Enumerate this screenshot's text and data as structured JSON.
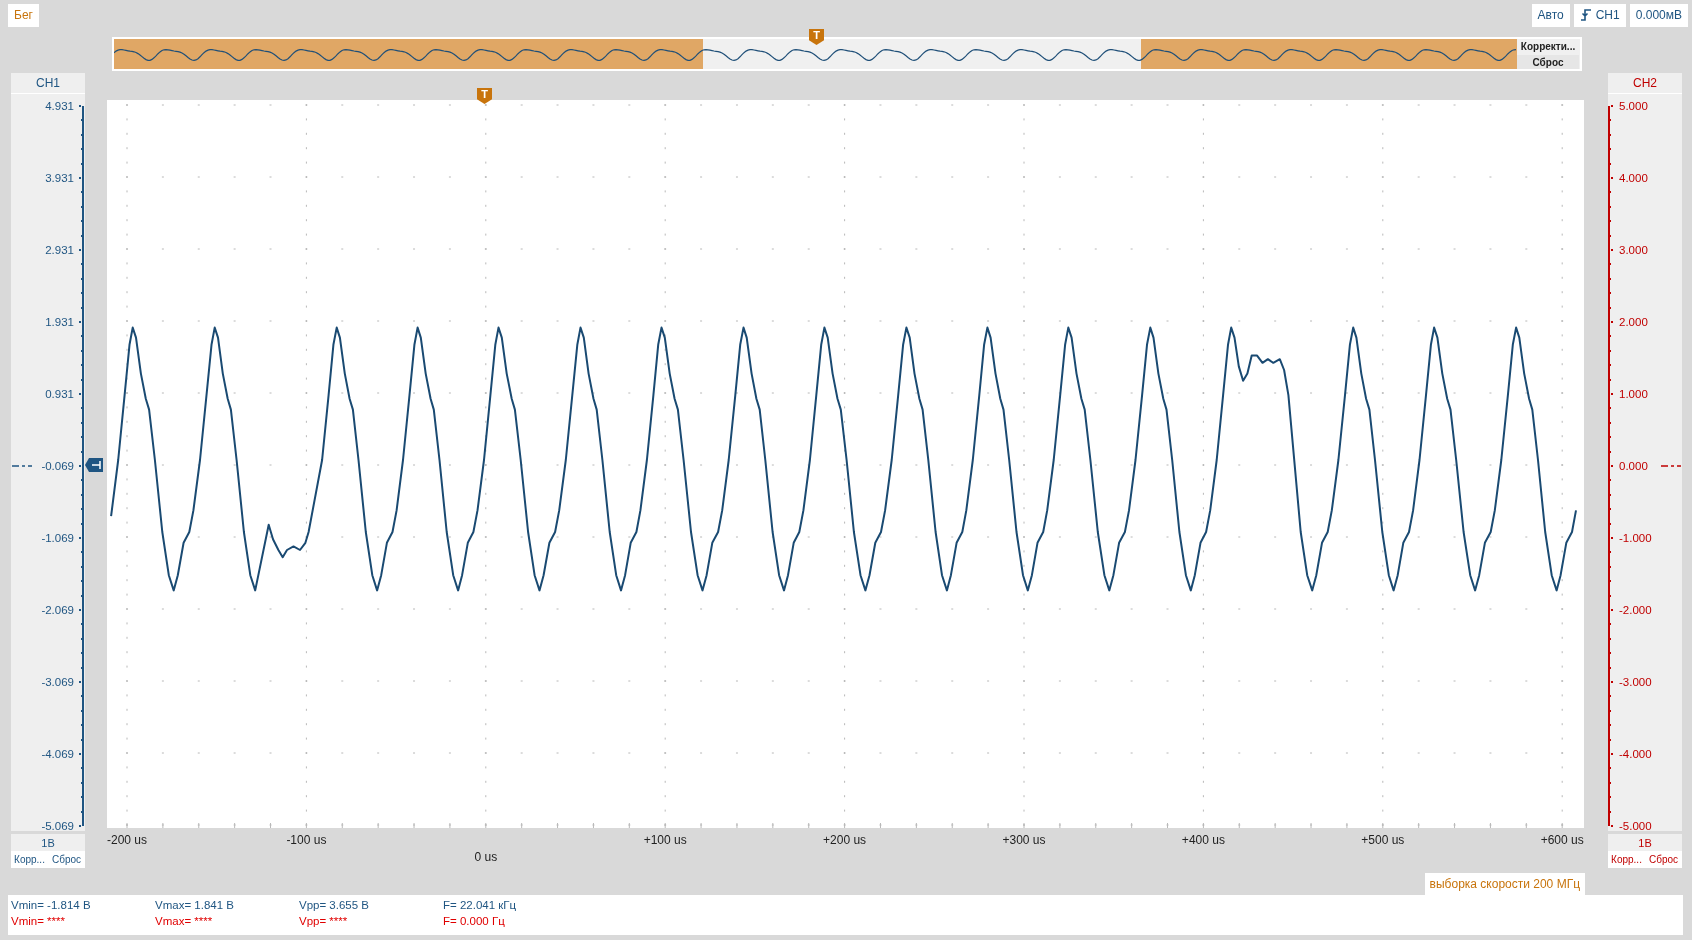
{
  "toolbar": {
    "run_button": "Бег",
    "mode_button": "Авто",
    "trigger_source": "CH1",
    "trigger_level": "0.000мВ"
  },
  "overview": {
    "trigger_marker": "T",
    "buttons": [
      "Корректи...",
      "Сброс"
    ]
  },
  "channels": [
    {
      "name": "CH1",
      "kind": "left",
      "enabled": true,
      "color": "#1f5582",
      "ticks": [
        "4.931",
        "3.931",
        "2.931",
        "1.931",
        "0.931",
        "-0.069",
        "-1.069",
        "-2.069",
        "-3.069",
        "-4.069",
        "-5.069"
      ],
      "scale": "1В",
      "buttons": [
        "Корр...",
        "Сброс"
      ]
    },
    {
      "name": "CH2",
      "kind": "right",
      "enabled": false,
      "color": "#c00000",
      "ticks": [
        "5.000",
        "4.000",
        "3.000",
        "2.000",
        "1.000",
        "0.000",
        "-1.000",
        "-2.000",
        "-3.000",
        "-4.000",
        "-5.000"
      ],
      "scale": "1В",
      "buttons": [
        "Корр...",
        "Сброс"
      ]
    }
  ],
  "plot": {
    "trigger_marker": "T",
    "x_ticks": [
      {
        "label": "-200 us",
        "kind": "normal"
      },
      {
        "label": "-100 us",
        "kind": "normal"
      },
      {
        "label": "0 us",
        "kind": "trigger"
      },
      {
        "label": "+100 us",
        "kind": "normal"
      },
      {
        "label": "+200 us",
        "kind": "normal"
      },
      {
        "label": "+300 us",
        "kind": "normal"
      },
      {
        "label": "+400 us",
        "kind": "normal"
      },
      {
        "label": "+500 us",
        "kind": "normal"
      },
      {
        "label": "+600 us",
        "kind": "normal"
      }
    ]
  },
  "sample_rate": "выборка скорости 200 МГц",
  "measurements": [
    {
      "color": "#1f5582",
      "values": [
        "Vmin= -1.814 В",
        "Vmax= 1.841 В",
        "Vpp= 3.655 В",
        "F= 22.041 кГц"
      ]
    },
    {
      "color": "#e00000",
      "values": [
        "Vmin= ****",
        "Vmax= ****",
        "Vpp= ****",
        "F= 0.000 Гц"
      ]
    }
  ]
}
